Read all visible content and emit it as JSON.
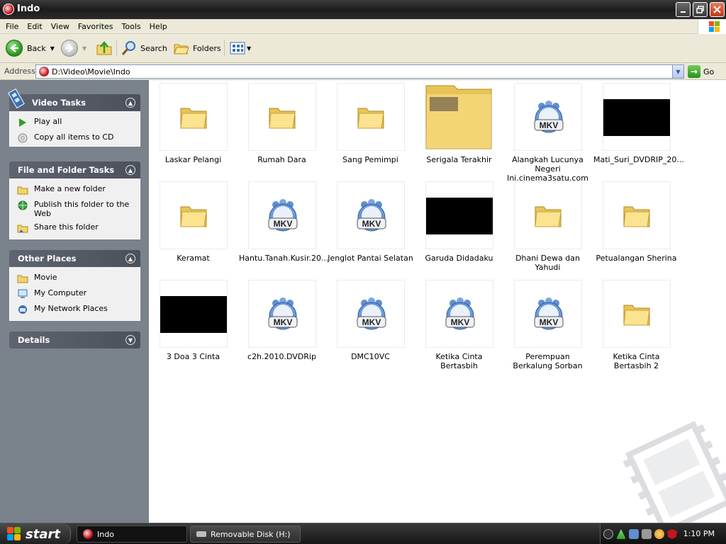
{
  "window": {
    "title": "Indo"
  },
  "menu": [
    "File",
    "Edit",
    "View",
    "Favorites",
    "Tools",
    "Help"
  ],
  "toolbar": {
    "back_label": "Back",
    "search_label": "Search",
    "folders_label": "Folders"
  },
  "address": {
    "label": "Address",
    "value": "D:\\Video\\Movie\\Indo",
    "go_label": "Go"
  },
  "task_pane": {
    "video_tasks": {
      "title": "Video Tasks",
      "items": [
        "Play all",
        "Copy all items to CD"
      ]
    },
    "file_folder_tasks": {
      "title": "File and Folder Tasks",
      "items": [
        "Make a new folder",
        "Publish this folder to the Web",
        "Share this folder"
      ]
    },
    "other_places": {
      "title": "Other Places",
      "items": [
        "Movie",
        "My Computer",
        "My Network Places"
      ]
    },
    "details": {
      "title": "Details"
    }
  },
  "items": [
    {
      "name": "Laskar Pelangi",
      "type": "folder"
    },
    {
      "name": "Rumah Dara",
      "type": "folder"
    },
    {
      "name": "Sang Pemimpi",
      "type": "folder"
    },
    {
      "name": "Serigala Terakhir",
      "type": "folder-thumb"
    },
    {
      "name": "Alangkah Lucunya Negeri Ini.cinema3satu.com",
      "type": "mkv"
    },
    {
      "name": "Mati_Suri_DVDRIP_20...",
      "type": "video-thumb"
    },
    {
      "name": "Keramat",
      "type": "folder"
    },
    {
      "name": "Hantu.Tanah.Kusir.20...",
      "type": "mkv"
    },
    {
      "name": "Jenglot Pantai Selatan",
      "type": "mkv"
    },
    {
      "name": "Garuda Didadaku",
      "type": "video-thumb"
    },
    {
      "name": "Dhani Dewa dan Yahudi",
      "type": "folder"
    },
    {
      "name": "Petualangan Sherina",
      "type": "folder"
    },
    {
      "name": "3 Doa 3 Cinta",
      "type": "video-thumb"
    },
    {
      "name": "c2h.2010.DVDRip",
      "type": "mkv"
    },
    {
      "name": "DMC10VC",
      "type": "mkv"
    },
    {
      "name": "Ketika Cinta Bertasbih",
      "type": "mkv"
    },
    {
      "name": "Perempuan Berkalung Sorban",
      "type": "mkv"
    },
    {
      "name": "Ketika Cinta Bertasbih 2",
      "type": "folder"
    }
  ],
  "mkv_label": "MKV",
  "taskbar": {
    "start_label": "start",
    "buttons": [
      "Indo",
      "Removable Disk (H:)"
    ],
    "clock": "1:10 PM"
  }
}
